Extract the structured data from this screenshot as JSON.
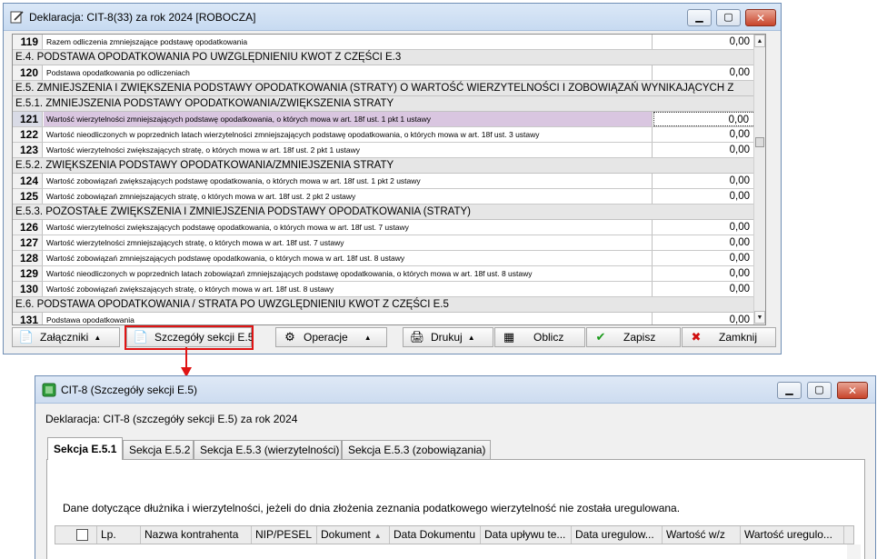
{
  "main_window": {
    "title": "Deklaracja: CIT-8(33) za rok 2024   [ROBOCZA]",
    "rows": [
      {
        "kind": "row",
        "num": "119",
        "desc": "Razem odliczenia zmniejszające podstawę opodatkowania",
        "val": "0,00"
      },
      {
        "kind": "sec",
        "text": "E.4. PODSTAWA OPODATKOWANIA PO UWZGLĘDNIENIU KWOT Z CZĘŚCI E.3"
      },
      {
        "kind": "row",
        "num": "120",
        "desc": "Podstawa opodatkowania po odliczeniach",
        "val": "0,00"
      },
      {
        "kind": "sec",
        "text": "E.5. ZMNIEJSZENIA I ZWIĘKSZENIA PODSTAWY OPODATKOWANIA (STRATY) O WARTOŚĆ WIERZYTELNOŚCI I ZOBOWIĄZAŃ WYNIKAJĄCYCH Z"
      },
      {
        "kind": "sec",
        "text": "E.5.1. ZMNIEJSZENIA PODSTAWY OPODATKOWANIA/ZWIĘKSZENIA STRATY"
      },
      {
        "kind": "row",
        "num": "121",
        "desc": "Wartość wierzytelności zmniejszających podstawę opodatkowania, o których mowa w art. 18f ust. 1 pkt 1 ustawy",
        "val": "0,00",
        "selected": true
      },
      {
        "kind": "row",
        "num": "122",
        "desc": "Wartość nieodliczonych w poprzednich latach wierzytelności zmniejszających podstawę opodatkowania, o których mowa w art. 18f ust. 3 ustawy",
        "val": "0,00"
      },
      {
        "kind": "row",
        "num": "123",
        "desc": "Wartość wierzytelności zwiększających stratę, o których mowa w art. 18f ust. 2 pkt 1 ustawy",
        "val": "0,00"
      },
      {
        "kind": "sec",
        "text": "E.5.2. ZWIĘKSZENIA PODSTAWY OPODATKOWANIA/ZMNIEJSZENIA STRATY"
      },
      {
        "kind": "row",
        "num": "124",
        "desc": "Wartość zobowiązań zwiększających podstawę opodatkowania, o których mowa w art. 18f ust. 1 pkt 2 ustawy",
        "val": "0,00"
      },
      {
        "kind": "row",
        "num": "125",
        "desc": "Wartość zobowiązań zmniejszających stratę, o których mowa w art. 18f ust. 2 pkt 2 ustawy",
        "val": "0,00"
      },
      {
        "kind": "sec",
        "text": "E.5.3. POZOSTAŁE ZWIĘKSZENIA I ZMNIEJSZENIA PODSTAWY OPODATKOWANIA (STRATY)"
      },
      {
        "kind": "row",
        "num": "126",
        "desc": "Wartość wierzytelności zwiększających podstawę opodatkowania, o których mowa w art. 18f ust. 7 ustawy",
        "val": "0,00"
      },
      {
        "kind": "row",
        "num": "127",
        "desc": "Wartość wierzytelności zmniejszających stratę, o których mowa w art. 18f ust. 7 ustawy",
        "val": "0,00"
      },
      {
        "kind": "row",
        "num": "128",
        "desc": "Wartość zobowiązań zmniejszających podstawę opodatkowania, o których mowa w art. 18f ust. 8 ustawy",
        "val": "0,00"
      },
      {
        "kind": "row",
        "num": "129",
        "desc": "Wartość nieodliczonych w poprzednich latach zobowiązań zmniejszających podstawę opodatkowania, o których mowa w art. 18f ust. 8 ustawy",
        "val": "0,00"
      },
      {
        "kind": "row",
        "num": "130",
        "desc": "Wartość zobowiązań zwiększających stratę, o których mowa w art. 18f ust. 8 ustawy",
        "val": "0,00"
      },
      {
        "kind": "sec",
        "text": "E.6. PODSTAWA OPODATKOWANIA / STRATA PO UWZGLĘDNIENIU KWOT Z CZĘŚCI E.5"
      },
      {
        "kind": "row",
        "num": "131",
        "desc": "Podstawa opodatkowania",
        "val": "0,00"
      }
    ],
    "toolbar": {
      "zalaczniki": "Załączniki",
      "szczegoly": "Szczegóły sekcji E.5",
      "operacje": "Operacje",
      "drukuj": "Drukuj",
      "oblicz": "Oblicz",
      "zapisz": "Zapisz",
      "zamknij": "Zamknij"
    }
  },
  "detail_window": {
    "title": "CIT-8 (Szczegóły sekcji E.5)",
    "declaration_label": "Deklaracja:  CIT-8 (szczegóły sekcji E.5) za rok 2024",
    "tabs": [
      "Sekcja E.5.1",
      "Sekcja E.5.2",
      "Sekcja E.5.3 (wierzytelności)",
      "Sekcja E.5.3 (zobowiązania)"
    ],
    "description": "Dane dotyczące dłużnika i wierzytelności, jeżeli do dnia złożenia zeznania podatkowego wierzytelność nie została uregulowana.",
    "columns": [
      "Lp.",
      "Nazwa kontrahenta",
      "NIP/PESEL",
      "Dokument",
      "Data Dokumentu",
      "Data upływu te...",
      "Data uregulow...",
      "Wartość w/z",
      "Wartość uregulo..."
    ]
  },
  "colors": {
    "highlight_border": "#e01414",
    "selected_row": "#d9c6e0",
    "section_bg": "#e6e6e6"
  }
}
